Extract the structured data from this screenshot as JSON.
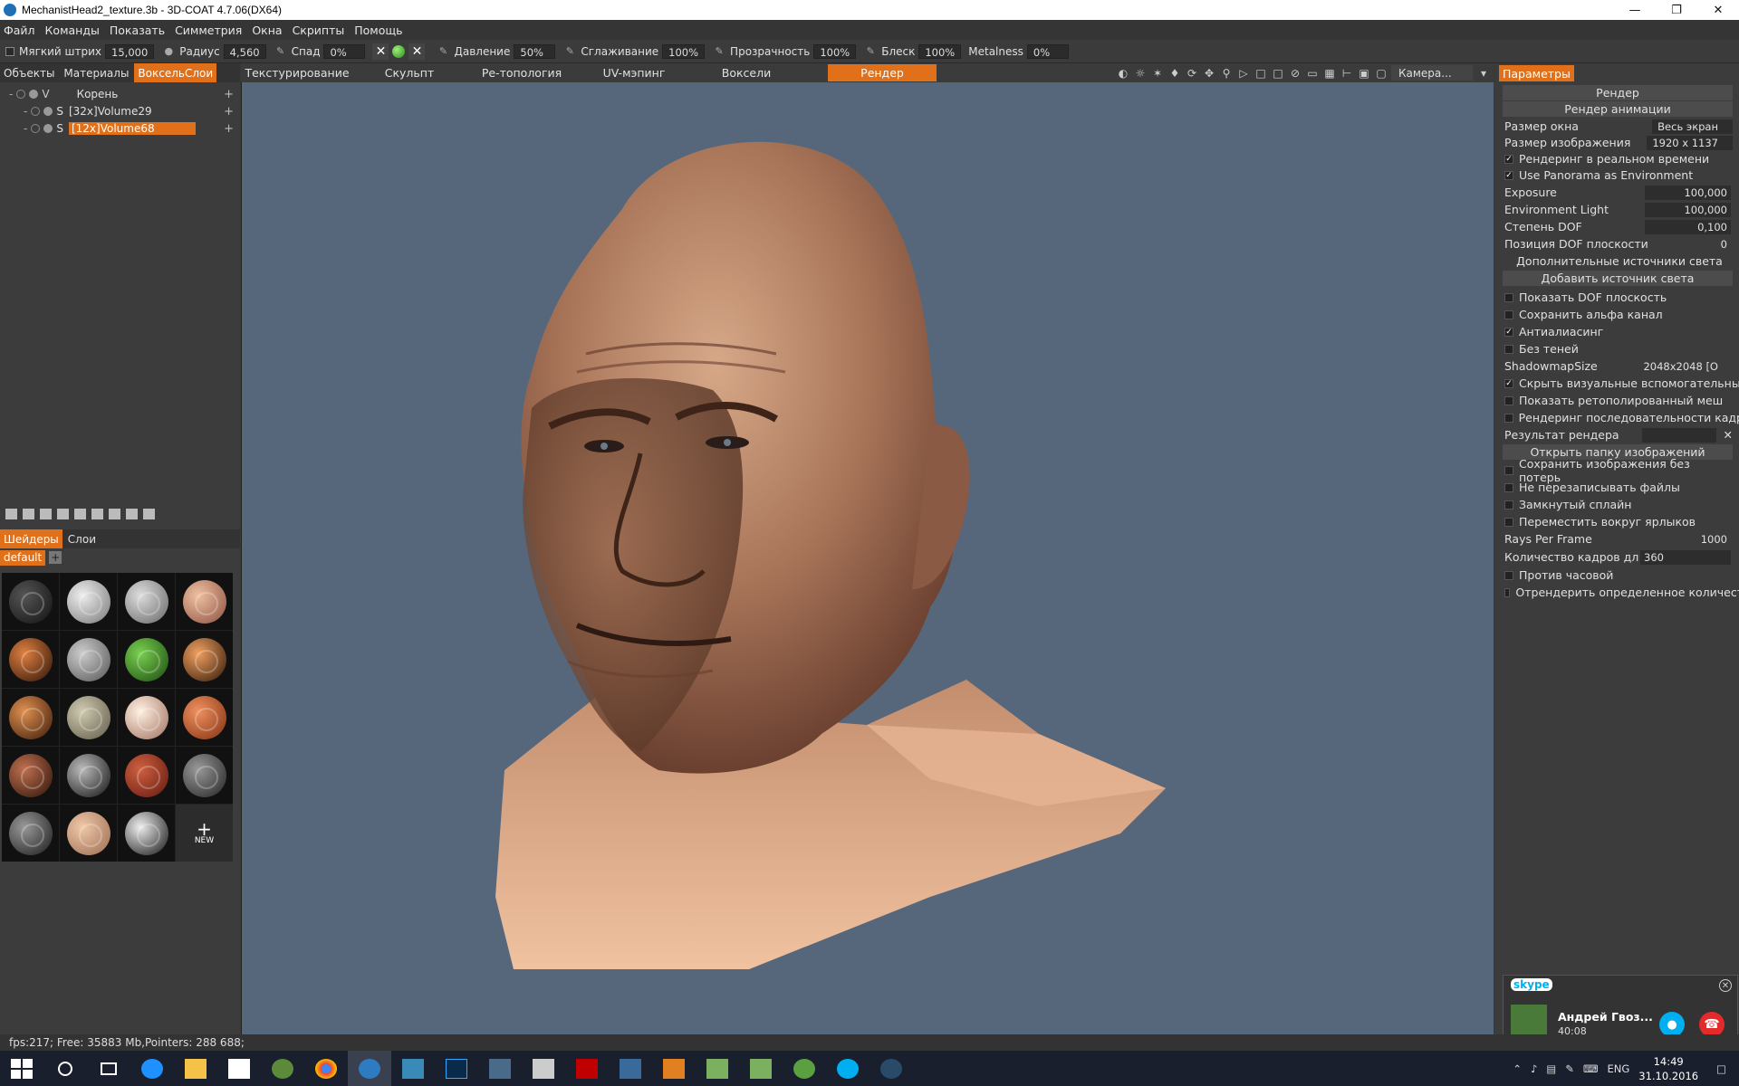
{
  "window": {
    "title": "MechanistHead2_texture.3b - 3D-COAT 4.7.06(DX64)"
  },
  "menu": [
    "Файл",
    "Команды",
    "Показать",
    "Симметрия",
    "Окна",
    "Скрипты",
    "Помощь"
  ],
  "brush": {
    "soft_stroke_label": "Мягкий штрих",
    "soft_stroke_value": "15,000",
    "radius_label": "Радиус",
    "radius_value": "4,560",
    "falloff_label": "Спад",
    "falloff_value": "0%",
    "pressure_label": "Давление",
    "pressure_value": "50%",
    "smoothing_label": "Сглаживание",
    "smoothing_value": "100%",
    "opacity_label": "Прозрачность",
    "opacity_value": "100%",
    "gloss_label": "Блеск",
    "gloss_value": "100%",
    "metalness_label": "Metalness",
    "metalness_value": "0%"
  },
  "left": {
    "tabs": [
      "Объекты",
      "Материалы",
      "ВоксельСлои"
    ],
    "root_label": "Корень",
    "layers": [
      {
        "prefix": "S",
        "name": "[32x]Volume29"
      },
      {
        "prefix": "S",
        "name": "[12x]Volume68"
      }
    ],
    "shader_tabs": [
      "Шейдеры",
      "Слои"
    ],
    "shader_preset": "default",
    "new_label": "NEW"
  },
  "modetabs": [
    "Текстурирование",
    "Скульпт",
    "Ре-топология",
    "UV-мэпинг",
    "Воксели",
    "Рендер"
  ],
  "camera_label": "Камера...",
  "right": {
    "header": "Параметры",
    "render_btn": "Рендер",
    "anim_btn": "Рендер анимации",
    "window_size_label": "Размер окна",
    "window_size_value": "Весь экран",
    "image_size_label": "Размер изображения",
    "image_size_value": "1920 x 1137",
    "realtime_label": "Рендеринг в реальном времени",
    "panorama_label": "Use Panorama as Environment",
    "exposure_label": "Exposure",
    "exposure_value": "100,000",
    "env_light_label": "Environment Light",
    "env_light_value": "100,000",
    "dof_label": "Степень DOF",
    "dof_value": "0,100",
    "dof_pos_label": "Позиция DOF плоскости",
    "dof_pos_value": "0",
    "extra_lights": "Дополнительные источники света",
    "add_light_btn": "Добавить источник света",
    "show_dof": "Показать DOF плоскость",
    "save_alpha": "Сохранить альфа канал",
    "antialias": "Антиалиасинг",
    "no_shadows": "Без теней",
    "shadowmap_label": "ShadowmapSize",
    "shadowmap_value": "2048x2048 [O",
    "hide_helpers": "Скрыть визуальные вспомогательны",
    "show_retopo": "Показать ретополированный меш",
    "render_sequence": "Рендеринг последовательности кадр",
    "result_label": "Результат рендера",
    "open_folder_btn": "Открыть папку изображений",
    "save_lossless": "Сохранить изображения без потерь",
    "no_overwrite": "Не перезаписывать файлы",
    "closed_spline": "Замкнутый сплайн",
    "move_around": "Переместить вокруг ярлыков",
    "rays_label": "Rays Per Frame",
    "rays_value": "1000",
    "frames_label": "Количество кадров дл",
    "frames_value": "360",
    "ccw_label": "Против часовой",
    "render_count_label": "Отрендерить определенное количест"
  },
  "skype": {
    "brand": "skype",
    "contact": "Андрей Гвоз...",
    "duration": "40:08"
  },
  "status": {
    "text": "fps:217;  Free: 35883 Mb,Pointers: 288 688;"
  },
  "taskbar": {
    "lang": "ENG",
    "time": "14:49",
    "date": "31.10.2016"
  },
  "colors": {
    "accent": "#e0701a",
    "viewport_bg": "#56677c"
  }
}
